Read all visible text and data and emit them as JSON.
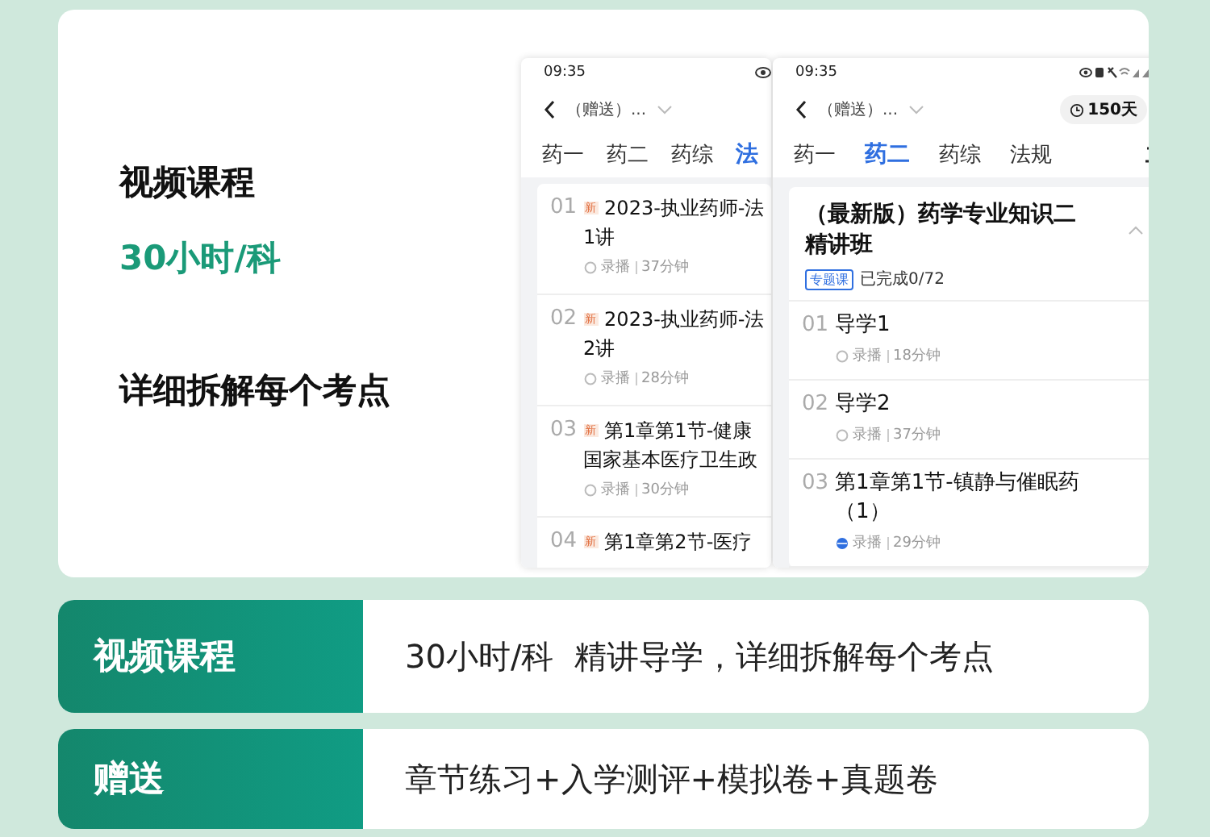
{
  "feature_card": {
    "labels": [
      {
        "text": "视频课程",
        "kind": "plain"
      },
      {
        "text": "30小时/科",
        "kind": "highlight"
      },
      {
        "text": "详细拆解每个考点",
        "kind": "plain"
      }
    ],
    "phones": [
      {
        "time": "09:35",
        "title": "（赠送）...",
        "tabs": [
          {
            "label": "药一",
            "selected": false
          },
          {
            "label": "药二",
            "selected": false
          },
          {
            "label": "药综",
            "selected": false
          },
          {
            "label": "法",
            "selected": true
          }
        ],
        "lessons": [
          {
            "number": "01",
            "badge": "新",
            "lines": [
              "2023-执业药师-法",
              "1讲"
            ],
            "type": "录播",
            "duration": "37分钟",
            "started": false
          },
          {
            "number": "02",
            "badge": "新",
            "lines": [
              "2023-执业药师-法",
              "2讲"
            ],
            "type": "录播",
            "duration": "28分钟",
            "started": false
          },
          {
            "number": "03",
            "badge": "新",
            "lines": [
              "第1章第1节-健康",
              "国家基本医疗卫生政"
            ],
            "type": "录播",
            "duration": "30分钟",
            "started": false
          },
          {
            "number": "04",
            "badge": "新",
            "lines": [
              "第1章第2节-医疗"
            ]
          }
        ]
      },
      {
        "time": "09:35",
        "title": "（赠送）...",
        "duration": "150天",
        "tabs": [
          {
            "label": "药一",
            "selected": false
          },
          {
            "label": "药二",
            "selected": true
          },
          {
            "label": "药综",
            "selected": false
          },
          {
            "label": "法规",
            "selected": false
          }
        ],
        "course": {
          "lines": [
            "（最新版）药学专业知识二",
            "精讲班"
          ],
          "tag": "专题课",
          "progress": "已完成0/72",
          "expanded": true
        },
        "lessons": [
          {
            "number": "01",
            "lines": [
              "导学1"
            ],
            "type": "录播",
            "duration": "18分钟",
            "started": false
          },
          {
            "number": "02",
            "lines": [
              "导学2"
            ],
            "type": "录播",
            "duration": "37分钟",
            "started": false
          },
          {
            "number": "03",
            "lines": [
              "第1章第1节-镇静与催眠药",
              "（1）"
            ],
            "type": "录播",
            "duration": "29分钟",
            "started": true
          }
        ]
      }
    ]
  },
  "rows": [
    {
      "label": "视频课程",
      "text": "30小时/科  精讲导学，详细拆解每个考点"
    },
    {
      "label": "赠送",
      "text": "章节练习+入学测评+模拟卷+真题卷"
    }
  ]
}
